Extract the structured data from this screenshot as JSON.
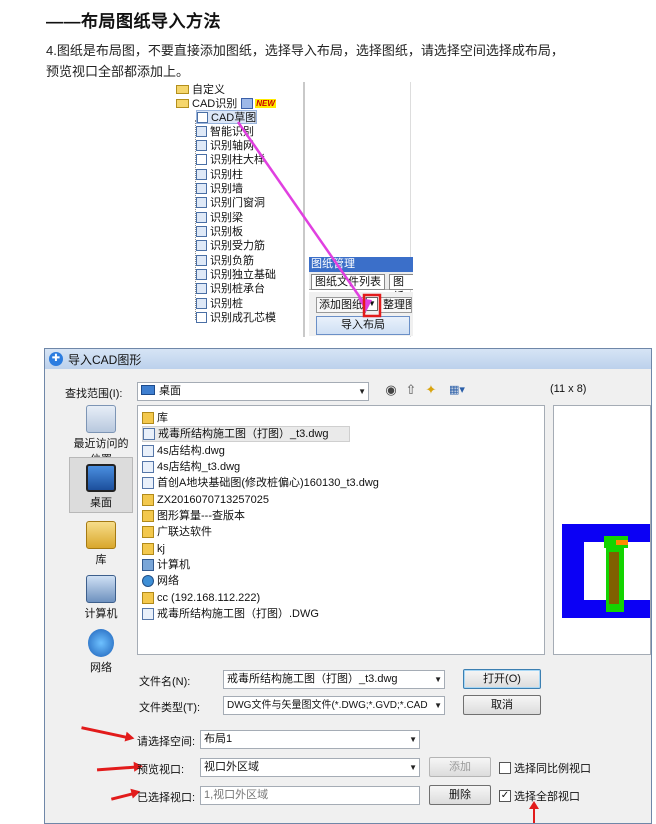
{
  "heading": "——布局图纸导入方法",
  "paragraph": "4.图纸是布局图，不要直接添加图纸，选择导入布局，选择图纸，请选择空间选择成布局，预览视口全部都添加上。",
  "tree": {
    "items": [
      {
        "label": "自定义",
        "type": "folder"
      },
      {
        "label": "CAD识别",
        "type": "folder",
        "badge": "NEW"
      },
      {
        "label": "CAD草图",
        "type": "cad"
      },
      {
        "label": "智能识别",
        "type": "item"
      },
      {
        "label": "识别轴网",
        "type": "item"
      },
      {
        "label": "识别柱大样",
        "type": "cad"
      },
      {
        "label": "识别柱",
        "type": "item"
      },
      {
        "label": "识别墙",
        "type": "item"
      },
      {
        "label": "识别门窗洞",
        "type": "item"
      },
      {
        "label": "识别梁",
        "type": "item"
      },
      {
        "label": "识别板",
        "type": "item"
      },
      {
        "label": "识别受力筋",
        "type": "item"
      },
      {
        "label": "识别负筋",
        "type": "item"
      },
      {
        "label": "识别独立基础",
        "type": "item"
      },
      {
        "label": "识别桩承台",
        "type": "item"
      },
      {
        "label": "识别桩",
        "type": "item"
      },
      {
        "label": "识别成孔芯模",
        "type": "cad"
      }
    ]
  },
  "drawing_manager": {
    "title": "图纸管理",
    "tabs": [
      "图纸文件列表",
      "图纸"
    ],
    "add_label": "添加图纸",
    "arrange_label": "整理图",
    "import_label": "导入布局"
  },
  "dialog": {
    "title": "导入CAD图形",
    "look_in_label": "查找范围(I):",
    "look_in_value": "桌面",
    "preview_label": "(11 x 8)",
    "places": [
      "最近访问的位置",
      "桌面",
      "库",
      "计算机",
      "网络"
    ],
    "files": [
      {
        "name": "库",
        "type": "folder"
      },
      {
        "name": "戒毒所结构施工图（打图）_t3.dwg",
        "type": "dwg"
      },
      {
        "name": "4s店结构.dwg",
        "type": "dwg"
      },
      {
        "name": "4s店结构_t3.dwg",
        "type": "dwg"
      },
      {
        "name": "首创A地块基础图(修改桩偏心)160130_t3.dwg",
        "type": "dwg"
      },
      {
        "name": "ZX2016070713257025",
        "type": "folder"
      },
      {
        "name": "图形算量---查版本",
        "type": "folder"
      },
      {
        "name": "广联达软件",
        "type": "folder"
      },
      {
        "name": "kj",
        "type": "folder"
      },
      {
        "name": "计算机",
        "type": "pc"
      },
      {
        "name": "网络",
        "type": "net"
      },
      {
        "name": "cc (192.168.112.222)",
        "type": "folder"
      },
      {
        "name": "戒毒所结构施工图（打图）.DWG",
        "type": "dwg"
      }
    ],
    "filename_label": "文件名(N):",
    "filename_value": "戒毒所结构施工图（打图）_t3.dwg",
    "filetype_label": "文件类型(T):",
    "filetype_value": "DWG文件与矢量图文件(*.DWG;*.GVD;*.CAD",
    "open_label": "打开(O)",
    "cancel_label": "取消",
    "space_label": "请选择空间:",
    "space_value": "布局1",
    "viewport_label": "预览视口:",
    "viewport_value": "视口外区域",
    "add_label": "添加",
    "same_scale_label": "选择同比例视口",
    "selected_label": "已选择视口:",
    "selected_value": "1,视口外区域",
    "delete_label": "删除",
    "select_all_label": "选择全部视口"
  },
  "colors": {
    "accent": "#3b6fc9",
    "arrow": "#e21b1b",
    "magenta": "#e040e0",
    "preview_blue": "#0b00f5",
    "preview_green": "#13d400"
  }
}
